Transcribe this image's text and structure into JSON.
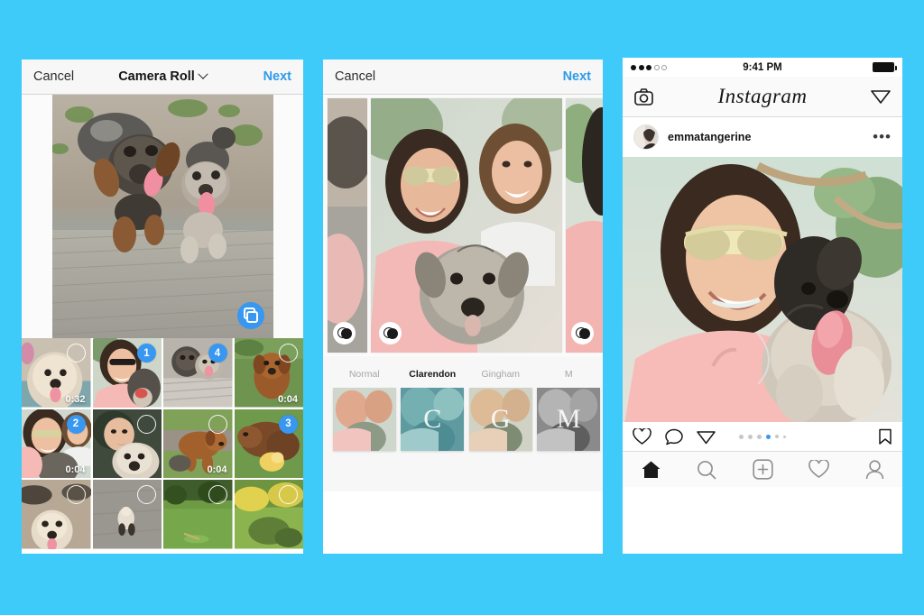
{
  "background_color": "#3ecbfa",
  "accent_color": "#3897f0",
  "phone1": {
    "name": "camera-roll-picker",
    "nav": {
      "cancel_label": "Cancel",
      "title": "Camera Roll",
      "next_label": "Next",
      "chevron_icon": "chevron-down-icon"
    },
    "preview": {
      "multi_select_icon": "multi-select-squares-icon"
    },
    "grid": [
      {
        "badge": "",
        "ring": true,
        "duration": "0:32"
      },
      {
        "badge": "1",
        "ring": false,
        "duration": ""
      },
      {
        "badge": "4",
        "ring": false,
        "duration": ""
      },
      {
        "badge": "",
        "ring": true,
        "duration": "0:04"
      },
      {
        "badge": "2",
        "ring": false,
        "duration": "0:04"
      },
      {
        "badge": "",
        "ring": true,
        "duration": ""
      },
      {
        "badge": "",
        "ring": true,
        "duration": "0:04"
      },
      {
        "badge": "3",
        "ring": false,
        "duration": ""
      },
      {
        "badge": "",
        "ring": true,
        "duration": ""
      },
      {
        "badge": "",
        "ring": true,
        "duration": ""
      },
      {
        "badge": "",
        "ring": true,
        "duration": ""
      },
      {
        "badge": "",
        "ring": true,
        "duration": ""
      }
    ]
  },
  "phone2": {
    "name": "filter-editor",
    "nav": {
      "cancel_label": "Cancel",
      "next_label": "Next"
    },
    "adjust_icon": "filter-circles-icon",
    "filters": [
      {
        "label": "Normal",
        "letter": "",
        "selected": false
      },
      {
        "label": "Clarendon",
        "letter": "C",
        "selected": true
      },
      {
        "label": "Gingham",
        "letter": "G",
        "selected": false
      },
      {
        "label": "M",
        "letter": "M",
        "selected": false
      }
    ]
  },
  "phone3": {
    "name": "instagram-feed",
    "status": {
      "time": "9:41 PM",
      "signal_filled": 3,
      "signal_empty": 2,
      "battery_icon": "battery-full-icon"
    },
    "header": {
      "camera_icon": "camera-icon",
      "logo_text": "Instagram",
      "direct_icon": "send-paperplane-icon"
    },
    "post": {
      "username": "emmatangerine",
      "more_label": "•••",
      "avatar_icon": "avatar"
    },
    "actions": {
      "like_icon": "heart-icon",
      "comment_icon": "comment-bubble-icon",
      "share_icon": "send-paperplane-icon",
      "save_icon": "bookmark-icon",
      "page_dots": [
        {
          "state": "off",
          "size": "md"
        },
        {
          "state": "off",
          "size": "md"
        },
        {
          "state": "off",
          "size": "md"
        },
        {
          "state": "on",
          "size": "md"
        },
        {
          "state": "off",
          "size": "sm"
        },
        {
          "state": "off",
          "size": "xs"
        }
      ]
    },
    "tabbar": [
      {
        "icon": "home-icon",
        "active": true
      },
      {
        "icon": "search-icon",
        "active": false
      },
      {
        "icon": "add-post-icon",
        "active": false
      },
      {
        "icon": "heart-icon",
        "active": false
      },
      {
        "icon": "profile-icon",
        "active": false
      }
    ]
  }
}
